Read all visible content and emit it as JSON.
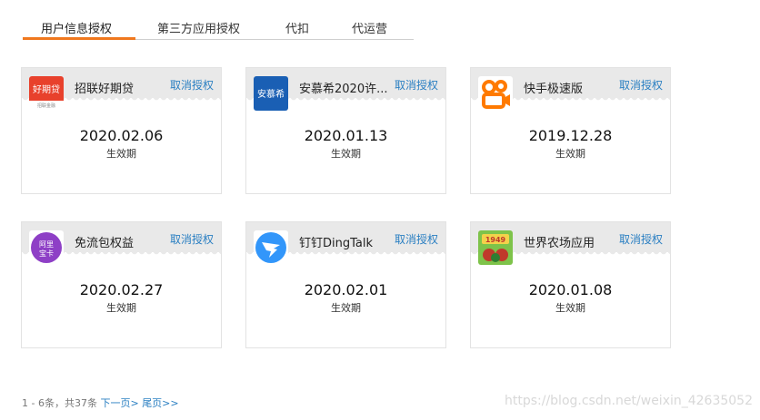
{
  "tabs": [
    {
      "label": "用户信息授权",
      "active": true
    },
    {
      "label": "第三方应用授权",
      "active": false
    },
    {
      "label": "代扣",
      "active": false
    },
    {
      "label": "代运营",
      "active": false
    }
  ],
  "accent_color": "#f0781e",
  "link_color": "#2a7fc2",
  "revoke_label": "取消授权",
  "date_caption": "生效期",
  "cards": [
    {
      "name": "招联好期贷",
      "date": "2020.02.06",
      "icon": "haoqidai-icon",
      "icon_text": "好期贷",
      "icon_subtext": "招联金融"
    },
    {
      "name": "安慕希2020许...",
      "date": "2020.01.13",
      "icon": "anmuxi-icon",
      "icon_text": "安慕希"
    },
    {
      "name": "快手极速版",
      "date": "2019.12.28",
      "icon": "kuaishou-icon"
    },
    {
      "name": "免流包权益",
      "date": "2020.02.27",
      "icon": "alibao-icon",
      "icon_text": "阿里宝卡"
    },
    {
      "name": "钉钉DingTalk",
      "date": "2020.02.01",
      "icon": "dingtalk-icon"
    },
    {
      "name": "世界农场应用",
      "date": "2020.01.08",
      "icon": "farm-icon",
      "icon_text": "1949"
    }
  ],
  "pagination": {
    "summary": "1 - 6条，共37条",
    "next": "下一页>",
    "last": "尾页>>"
  },
  "watermark": "https://blog.csdn.net/weixin_42635052"
}
